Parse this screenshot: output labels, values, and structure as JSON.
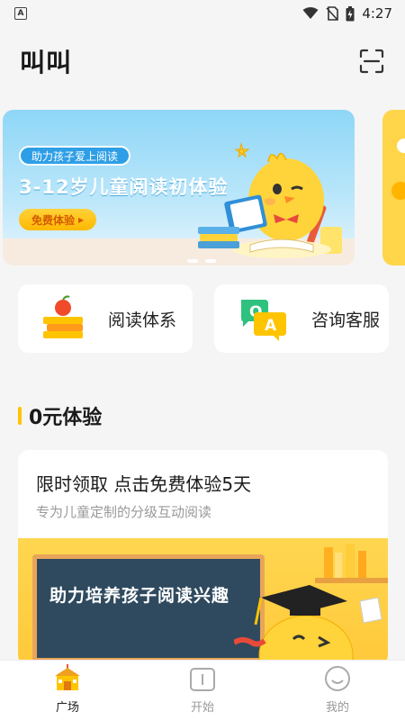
{
  "status_bar": {
    "time": "4:27"
  },
  "header": {
    "title": "叫叫"
  },
  "banner": {
    "tag": "助力孩子爱上阅读",
    "title": "3-12岁儿童阅读初体验",
    "cta": "免费体验"
  },
  "quick_links": [
    {
      "label": "阅读体系"
    },
    {
      "label": "咨询客服"
    }
  ],
  "section": {
    "title": "0元体验"
  },
  "promo": {
    "title": "限时领取 点击免费体验5天",
    "subtitle": "专为儿童定制的分级互动阅读",
    "board_text": "助力培养孩子阅读兴趣"
  },
  "bottom_nav": [
    {
      "label": "广场",
      "active": true
    },
    {
      "label": "开始",
      "active": false
    },
    {
      "label": "我的",
      "active": false
    }
  ],
  "colors": {
    "accent": "#ffc400",
    "banner_blue": "#2e9fe6"
  }
}
